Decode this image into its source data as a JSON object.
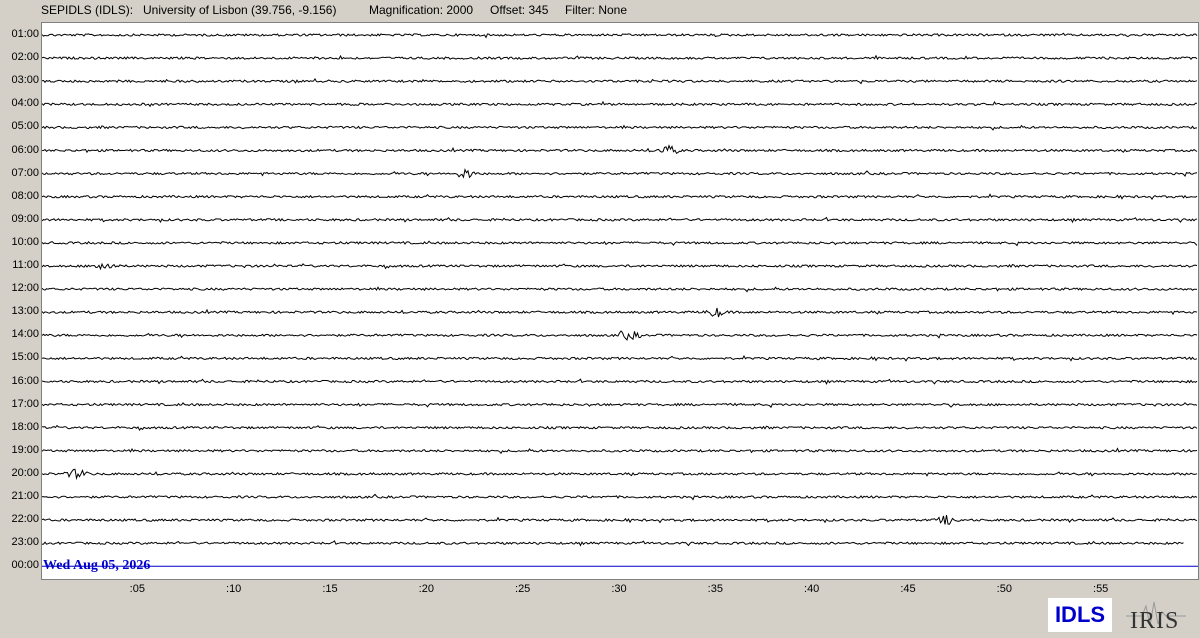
{
  "header": {
    "station": "SEPIDLS (IDLS):",
    "location": "University of Lisbon (39.756, -9.156)",
    "magnification": "Magnification: 2000",
    "offset": "Offset: 345",
    "filter": "Filter: None"
  },
  "date_label": "Wed Aug 05, 2026",
  "logos": {
    "idls": "IDLS",
    "iris": "IRIS"
  },
  "colors": {
    "trace": "#000000",
    "current_hour_line": "#0000cc",
    "date_label": "#0000cc",
    "background": "#d4d0c8",
    "plot_background": "#ffffff"
  },
  "chart_data": {
    "type": "line",
    "title": "",
    "xlabel": "",
    "ylabel": "",
    "x_unit": "minutes past the hour",
    "xlim": [
      0,
      60
    ],
    "x_ticks": [
      ":05",
      ":10",
      ":15",
      ":20",
      ":25",
      ":30",
      ":35",
      ":40",
      ":45",
      ":50",
      ":55"
    ],
    "row_labels": [
      "01:00",
      "02:00",
      "03:00",
      "04:00",
      "05:00",
      "06:00",
      "07:00",
      "08:00",
      "09:00",
      "10:00",
      "11:00",
      "12:00",
      "13:00",
      "14:00",
      "15:00",
      "16:00",
      "17:00",
      "18:00",
      "19:00",
      "20:00",
      "21:00",
      "22:00",
      "23:00",
      "00:00"
    ],
    "grid": false,
    "legend": "none",
    "series_note": "24 helicorder rows of continuous seismic trace (one per hour); the 00:00 row is the current hour and has no trace yet, only a blue baseline",
    "events": [
      {
        "row": "06:00",
        "minute": 32.5
      },
      {
        "row": "07:00",
        "minute": 22.0
      },
      {
        "row": "11:00",
        "minute": 3.2
      },
      {
        "row": "13:00",
        "minute": 35.0
      },
      {
        "row": "14:00",
        "minute": 30.5
      },
      {
        "row": "20:00",
        "minute": 1.8
      },
      {
        "row": "22:00",
        "minute": 47.0
      }
    ],
    "last_trace_row": "23:00",
    "last_trace_end_minute": 59.3
  }
}
